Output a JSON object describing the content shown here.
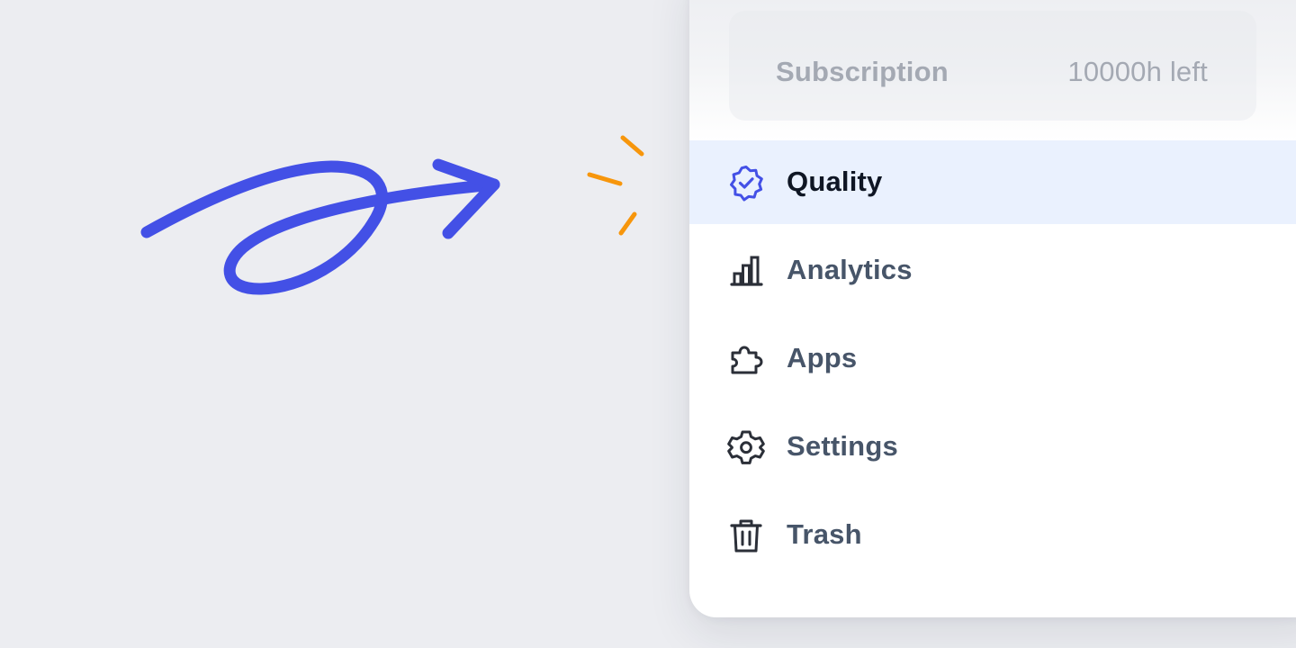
{
  "subscription": {
    "label": "Subscription",
    "value": "10000h left"
  },
  "menu": {
    "items": [
      {
        "label": "Quality",
        "icon": "verified-badge-icon",
        "active": true
      },
      {
        "label": "Analytics",
        "icon": "bar-chart-icon",
        "active": false
      },
      {
        "label": "Apps",
        "icon": "puzzle-icon",
        "active": false
      },
      {
        "label": "Settings",
        "icon": "gear-icon",
        "active": false
      },
      {
        "label": "Trash",
        "icon": "trash-icon",
        "active": false
      }
    ]
  },
  "colors": {
    "background": "#ecedf1",
    "accent": "#4350e6",
    "spark": "#f7960c",
    "active_bg": "#eaf1fe",
    "label": "#475569",
    "label_active": "#0f1624",
    "muted": "#a4a9b3"
  }
}
